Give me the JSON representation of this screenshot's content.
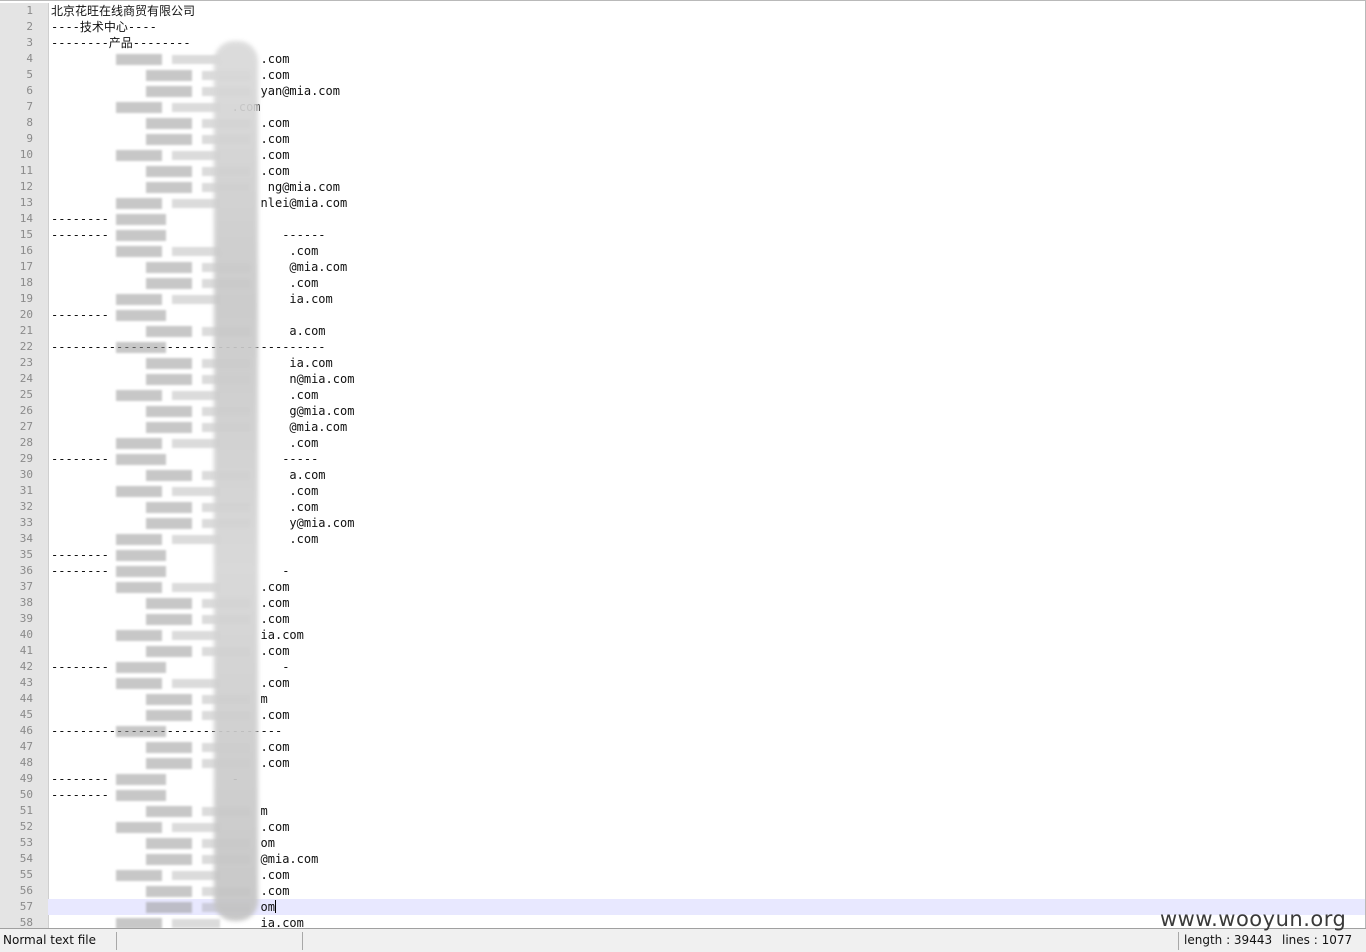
{
  "editor": {
    "lines": [
      {
        "n": "1",
        "text": "北京花旺在线商贸有限公司"
      },
      {
        "n": "2",
        "text": "----技术中心----"
      },
      {
        "n": "3",
        "text": "--------产品--------"
      },
      {
        "n": "4",
        "text": "                             .com"
      },
      {
        "n": "5",
        "text": "                             .com"
      },
      {
        "n": "6",
        "text": "                             yan@mia.com"
      },
      {
        "n": "7",
        "text": "                         .com"
      },
      {
        "n": "8",
        "text": "                             .com"
      },
      {
        "n": "9",
        "text": "                             .com"
      },
      {
        "n": "10",
        "text": "                             .com"
      },
      {
        "n": "11",
        "text": "                             .com"
      },
      {
        "n": "12",
        "text": "                              ng@mia.com"
      },
      {
        "n": "13",
        "text": "                             nlei@mia.com"
      },
      {
        "n": "14",
        "text": "--------"
      },
      {
        "n": "15",
        "text": "--------                        ------"
      },
      {
        "n": "16",
        "text": "                                 .com"
      },
      {
        "n": "17",
        "text": "                                 @mia.com"
      },
      {
        "n": "18",
        "text": "                                 .com"
      },
      {
        "n": "19",
        "text": "                                 ia.com"
      },
      {
        "n": "20",
        "text": "--------"
      },
      {
        "n": "21",
        "text": "                                 a.com"
      },
      {
        "n": "22",
        "text": "--------------------------------------"
      },
      {
        "n": "23",
        "text": "                                 ia.com"
      },
      {
        "n": "24",
        "text": "                                 n@mia.com"
      },
      {
        "n": "25",
        "text": "                                 .com"
      },
      {
        "n": "26",
        "text": "                                 g@mia.com"
      },
      {
        "n": "27",
        "text": "                                 @mia.com"
      },
      {
        "n": "28",
        "text": "                                 .com"
      },
      {
        "n": "29",
        "text": "--------                        -----"
      },
      {
        "n": "30",
        "text": "                                 a.com"
      },
      {
        "n": "31",
        "text": "                                 .com"
      },
      {
        "n": "32",
        "text": "                                 .com"
      },
      {
        "n": "33",
        "text": "                                 y@mia.com"
      },
      {
        "n": "34",
        "text": "                                 .com"
      },
      {
        "n": "35",
        "text": "--------"
      },
      {
        "n": "36",
        "text": "--------                        -"
      },
      {
        "n": "37",
        "text": "                             .com"
      },
      {
        "n": "38",
        "text": "                             .com"
      },
      {
        "n": "39",
        "text": "                             .com"
      },
      {
        "n": "40",
        "text": "                             ia.com"
      },
      {
        "n": "41",
        "text": "                             .com"
      },
      {
        "n": "42",
        "text": "--------                        -"
      },
      {
        "n": "43",
        "text": "                             .com"
      },
      {
        "n": "44",
        "text": "                             m"
      },
      {
        "n": "45",
        "text": "                             .com"
      },
      {
        "n": "46",
        "text": "--------------------------------"
      },
      {
        "n": "47",
        "text": "                             .com"
      },
      {
        "n": "48",
        "text": "                             .com"
      },
      {
        "n": "49",
        "text": "--------                 -"
      },
      {
        "n": "50",
        "text": "--------"
      },
      {
        "n": "51",
        "text": "                             m"
      },
      {
        "n": "52",
        "text": "                             .com"
      },
      {
        "n": "53",
        "text": "                             om"
      },
      {
        "n": "54",
        "text": "                             @mia.com"
      },
      {
        "n": "55",
        "text": "                             .com"
      },
      {
        "n": "56",
        "text": "                             .com"
      },
      {
        "n": "57",
        "text": "                             om"
      },
      {
        "n": "58",
        "text": "                             ia.com"
      }
    ],
    "current_line": "57"
  },
  "statusbar": {
    "file_type": "Normal text file",
    "length": "length : 39443",
    "lines": "lines : 1077"
  },
  "watermark": {
    "text": "www.wooyun.org"
  }
}
